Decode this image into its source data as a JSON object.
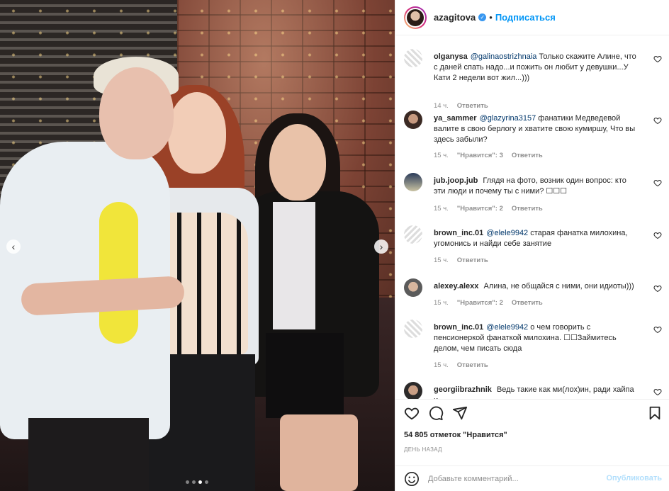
{
  "post": {
    "author": "azagitova",
    "header_separator": "•",
    "follow_label": "Подписаться",
    "carousel": {
      "total_slides": 4,
      "active_slide": 2
    }
  },
  "comments": [
    {
      "user": "olganysa",
      "mention": "@galinaostrizhnaia",
      "text": "Только скажите Алине, что с даней спать надо...и пожить он любит у девушки...У Кати 2 недели вот жил...)))",
      "time": "14 ч.",
      "likes": "",
      "reply": "Ответить"
    },
    {
      "user": "ya_sammer",
      "mention": "@glazyrina3157",
      "text": "фанатики Медведевой валите в свою берлогу и хватите свою кумиршу, Что вы здесь забыли?",
      "time": "15 ч.",
      "likes": "\"Нравится\": 3",
      "reply": "Ответить"
    },
    {
      "user": "jub.joop.jub",
      "mention": "",
      "text": "Глядя на фото, возник один вопрос: кто эти люди и почему ты с ними? ☐☐☐",
      "time": "15 ч.",
      "likes": "\"Нравится\": 2",
      "reply": "Ответить"
    },
    {
      "user": "brown_inc.01",
      "mention": "@elele9942",
      "text": "старая фанатка милохина, угомонись и найди себе занятие",
      "time": "15 ч.",
      "likes": "",
      "reply": "Ответить"
    },
    {
      "user": "alexey.alexx",
      "mention": "",
      "text": "Алина, не общайся с ними, они идиоты)))",
      "time": "15 ч.",
      "likes": "\"Нравится\": 2",
      "reply": "Ответить"
    },
    {
      "user": "brown_inc.01",
      "mention": "@elele9942",
      "text": "о чем говорить с пенсионеркой фанаткой милохина. ☐☐Займитесь делом, чем писать сюда",
      "time": "15 ч.",
      "likes": "",
      "reply": "Ответить"
    },
    {
      "user": "georgiibrazhnik",
      "mention": "",
      "text": "Ведь такие как ми(лох)ин, ради хайпа и",
      "time": "",
      "likes": "",
      "reply": ""
    }
  ],
  "footer": {
    "likes_count": "54 805",
    "likes_label": "отметок \"Нравится\"",
    "time_ago": "ДЕНЬ НАЗАД",
    "comment_placeholder": "Добавьте комментарий...",
    "publish_label": "Опубликовать"
  },
  "icons": {
    "like": "heart-icon",
    "comment": "comment-bubble-icon",
    "share": "paper-plane-icon",
    "save": "bookmark-icon",
    "emoji": "smiley-icon",
    "verified": "verified-badge-icon",
    "prev": "chevron-left-icon",
    "next": "chevron-right-icon"
  },
  "colors": {
    "accent": "#0095f6",
    "publish_disabled": "#b2dffc",
    "meta": "#8e8e8e",
    "verified": "#3897f0"
  }
}
